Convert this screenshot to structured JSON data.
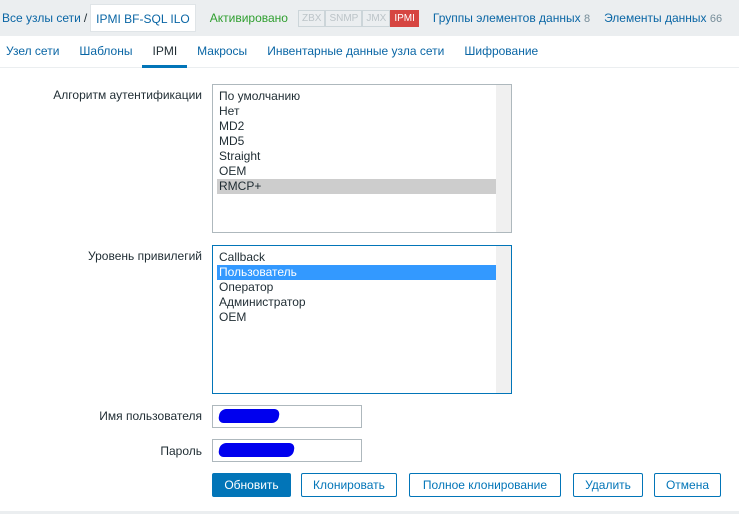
{
  "header": {
    "breadcrumb_root": "Все узлы сети",
    "separator": "/",
    "current_host": "IPMI BF-SQL ILO",
    "status": "Активировано",
    "tags": [
      {
        "label": "ZBX",
        "active": false
      },
      {
        "label": "SNMP",
        "active": false
      },
      {
        "label": "JMX",
        "active": false
      },
      {
        "label": "IPMI",
        "active": true
      }
    ],
    "item_groups_label": "Группы элементов данных",
    "item_groups_count": "8",
    "items_label": "Элементы данных",
    "items_count": "66"
  },
  "tabs": [
    "Узел сети",
    "Шаблоны",
    "IPMI",
    "Макросы",
    "Инвентарные данные узла сети",
    "Шифрование"
  ],
  "selected_tab": "IPMI",
  "form": {
    "auth_label": "Алгоритм аутентификации",
    "auth_options": [
      "По умолчанию",
      "Нет",
      "MD2",
      "MD5",
      "Straight",
      "OEM",
      "RMCP+"
    ],
    "auth_selected": "RMCP+",
    "priv_label": "Уровень привилегий",
    "priv_options": [
      "Callback",
      "Пользователь",
      "Оператор",
      "Администратор",
      "OEM"
    ],
    "priv_selected": "Пользователь",
    "username_label": "Имя пользователя",
    "password_label": "Пароль"
  },
  "buttons": {
    "update": "Обновить",
    "clone": "Клонировать",
    "full_clone": "Полное клонирование",
    "delete": "Удалить",
    "cancel": "Отмена"
  }
}
